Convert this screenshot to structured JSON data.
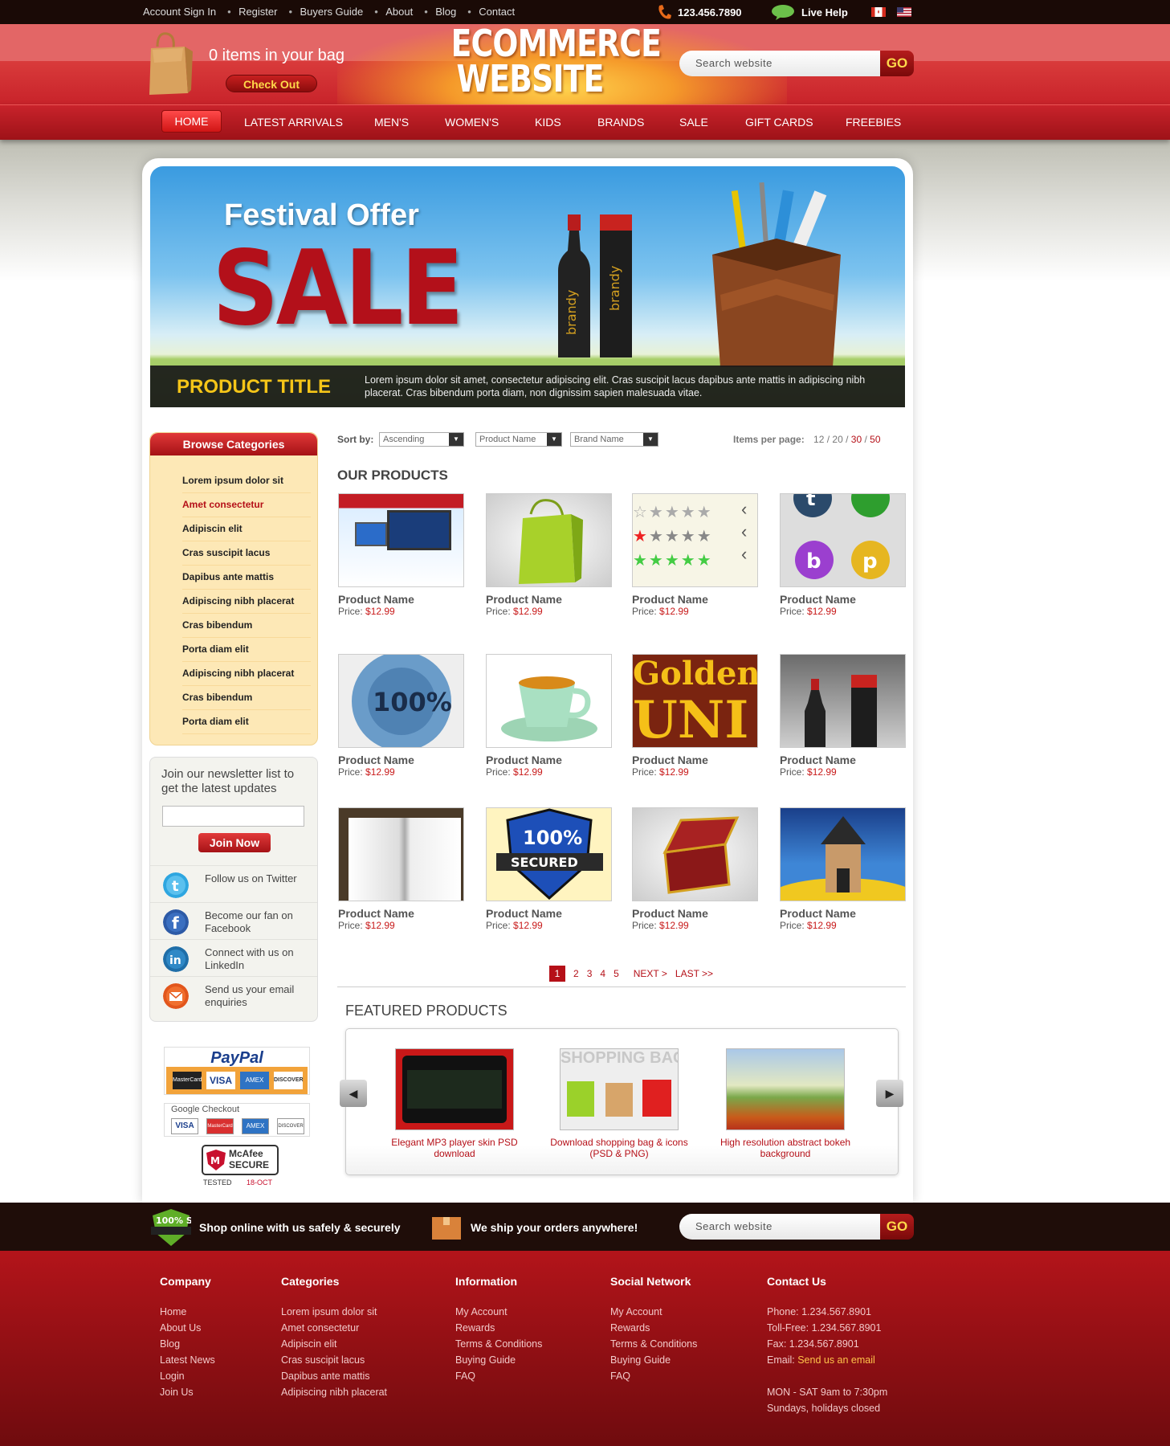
{
  "topbar": {
    "links": [
      "Account Sign In",
      "Register",
      "Buyers Guide",
      "About",
      "Blog",
      "Contact"
    ],
    "phone": "123.456.7890",
    "live_help": "Live Help"
  },
  "header": {
    "bag_text": "0 items in your bag",
    "checkout": "Check Out",
    "logo_line1": "ECOMMERCE",
    "logo_line2": "WEBSITE",
    "search_placeholder": "Search website",
    "search_go": "GO"
  },
  "nav": {
    "items": [
      "HOME",
      "LATEST ARRIVALS",
      "MEN'S",
      "WOMEN'S",
      "KIDS",
      "BRANDS",
      "SALE",
      "GIFT CARDS",
      "FREEBIES"
    ]
  },
  "banner": {
    "festival": "Festival Offer",
    "sale": "SALE",
    "bottle_label": "brandy",
    "product_title": "PRODUCT TITLE",
    "description": "Lorem ipsum dolor sit amet, consectetur adipiscing elit. Cras suscipit lacus dapibus ante mattis in adipiscing nibh placerat. Cras bibendum porta diam, non dignissim sapien malesuada vitae."
  },
  "sidebar": {
    "browse_title": "Browse Categories",
    "categories": [
      "Lorem ipsum dolor sit",
      "Amet consectetur",
      "Adipiscin elit",
      "Cras suscipit lacus",
      "Dapibus ante mattis",
      "Adipiscing nibh placerat",
      "Cras bibendum",
      "Porta diam elit",
      "Adipiscing nibh placerat",
      "Cras bibendum",
      "Porta diam elit"
    ],
    "newsletter_text": "Join our newsletter list to get the latest updates",
    "join_now": "Join Now",
    "social": [
      {
        "text": "Follow us on Twitter",
        "icon": "twitter-icon"
      },
      {
        "text": "Become our fan on Facebook",
        "icon": "facebook-icon"
      },
      {
        "text": "Connect with us on LinkedIn",
        "icon": "linkedin-icon"
      },
      {
        "text": "Send us your email enquiries",
        "icon": "email-icon"
      }
    ],
    "paypal": "PayPal",
    "google_checkout": "Google Checkout",
    "cards": [
      "MasterCard",
      "VISA",
      "AMEX",
      "DISCOVER"
    ],
    "mcafee": "McAfee SECURE",
    "mcafee_tested": "TESTED",
    "mcafee_date": "18-OCT"
  },
  "products": {
    "sort_by": "Sort by:",
    "sort_options": [
      "Ascending",
      "Product Name",
      "Brand Name"
    ],
    "items_per_page_label": "Items per page:",
    "items_per_page": [
      "12",
      "20",
      "30",
      "50"
    ],
    "section_title": "OUR PRODUCTS",
    "list": [
      {
        "name": "Product Name",
        "price_label": "Price:",
        "price": "$12.99"
      },
      {
        "name": "Product Name",
        "price_label": "Price:",
        "price": "$12.99"
      },
      {
        "name": "Product Name",
        "price_label": "Price:",
        "price": "$12.99"
      },
      {
        "name": "Product Name",
        "price_label": "Price:",
        "price": "$12.99"
      },
      {
        "name": "Product Name",
        "price_label": "Price:",
        "price": "$12.99"
      },
      {
        "name": "Product Name",
        "price_label": "Price:",
        "price": "$12.99"
      },
      {
        "name": "Product Name",
        "price_label": "Price:",
        "price": "$12.99"
      },
      {
        "name": "Product Name",
        "price_label": "Price:",
        "price": "$12.99"
      },
      {
        "name": "Product Name",
        "price_label": "Price:",
        "price": "$12.99"
      },
      {
        "name": "Product Name",
        "price_label": "Price:",
        "price": "$12.99"
      },
      {
        "name": "Product Name",
        "price_label": "Price:",
        "price": "$12.99"
      },
      {
        "name": "Product Name",
        "price_label": "Price:",
        "price": "$12.99"
      }
    ],
    "image_texts": {
      "satisfaction": "100%",
      "golden": "Golden",
      "golden2": "UNI",
      "secured": "100%",
      "secured2": "SECURED"
    },
    "pager": [
      "1",
      "2",
      "3",
      "4",
      "5",
      "NEXT >",
      "LAST >>"
    ]
  },
  "featured": {
    "title": "FEATURED PRODUCTS",
    "items": [
      {
        "title": "Elegant MP3 player skin PSD download"
      },
      {
        "title": "Download shopping bag & icons (PSD & PNG)"
      },
      {
        "title": "High resolution abstract bokeh background"
      }
    ],
    "shopping_bags_label": "SHOPPING BAGS"
  },
  "strip": {
    "secure_text": "Shop online with us safely & securely",
    "ship_text": "We ship your orders anywhere!",
    "badge_text": "100% SECURED",
    "search_placeholder": "Search website",
    "search_go": "GO"
  },
  "footer": {
    "company": {
      "title": "Company",
      "links": [
        "Home",
        "About Us",
        "Blog",
        "Latest News",
        "Login",
        "Join Us"
      ]
    },
    "categories": {
      "title": "Categories",
      "links": [
        "Lorem ipsum dolor sit",
        "Amet consectetur",
        "Adipiscin elit",
        "Cras suscipit lacus",
        "Dapibus ante mattis",
        "Adipiscing nibh placerat"
      ]
    },
    "information": {
      "title": "Information",
      "links": [
        "My Account",
        "Rewards",
        "Terms & Conditions",
        "Buying Guide",
        "FAQ"
      ]
    },
    "social": {
      "title": "Social Network",
      "links": [
        "My Account",
        "Rewards",
        "Terms & Conditions",
        "Buying Guide",
        "FAQ"
      ]
    },
    "contact": {
      "title": "Contact Us",
      "phone": "Phone: 1.234.567.8901",
      "tollfree": "Toll-Free: 1.234.567.8901",
      "fax": "Fax: 1.234.567.8901",
      "email_label": "Email:",
      "email_link": "Send us an email",
      "hours1": "MON - SAT 9am to 7:30pm",
      "hours2": "Sundays, holidays closed"
    }
  }
}
